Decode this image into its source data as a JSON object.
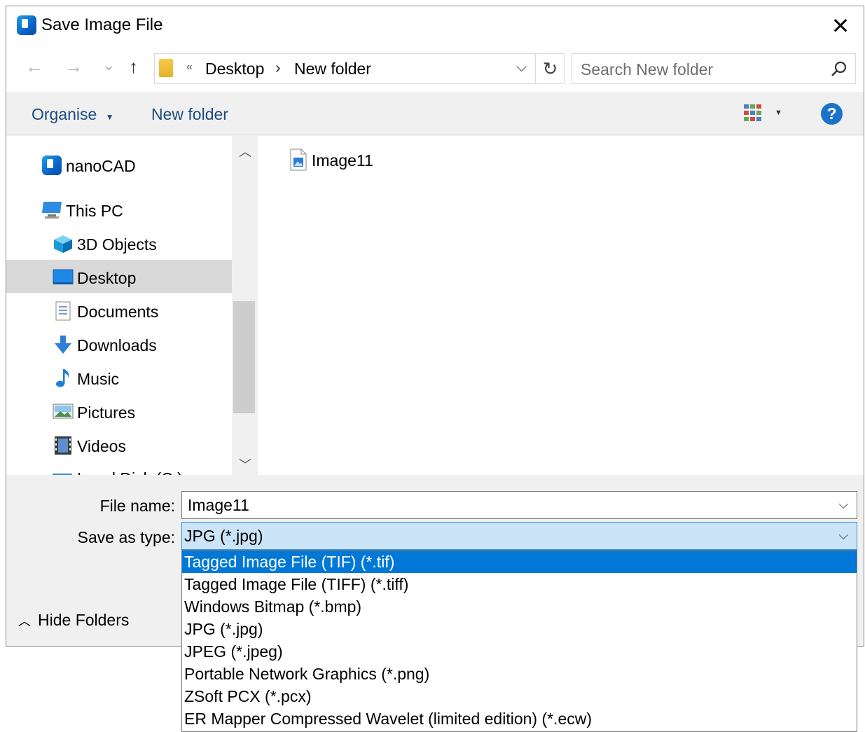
{
  "window": {
    "title": "Save Image File",
    "close_label": "✕"
  },
  "nav": {
    "back_icon": "←",
    "forward_icon": "→",
    "recent_icon": "⌄",
    "up_icon": "↑",
    "address": {
      "overflow": "«",
      "crumbs": [
        "Desktop",
        "New folder"
      ],
      "separator": "›"
    },
    "refresh_icon": "↻",
    "search_placeholder": "Search New folder"
  },
  "toolbar": {
    "organise_label": "Organise",
    "new_folder_label": "New folder"
  },
  "sidebar": {
    "items": [
      {
        "label": "nanoCAD",
        "icon": "nanocad-icon"
      },
      {
        "label": "This PC",
        "icon": "computer-icon"
      },
      {
        "label": "3D Objects",
        "icon": "cube-icon"
      },
      {
        "label": "Desktop",
        "icon": "desktop-icon",
        "selected": true
      },
      {
        "label": "Documents",
        "icon": "document-icon"
      },
      {
        "label": "Downloads",
        "icon": "download-icon"
      },
      {
        "label": "Music",
        "icon": "music-icon"
      },
      {
        "label": "Pictures",
        "icon": "picture-icon"
      },
      {
        "label": "Videos",
        "icon": "video-icon"
      },
      {
        "label": "Local Disk (C:)",
        "icon": "drive-icon"
      }
    ]
  },
  "files": [
    {
      "name": "Image11",
      "icon": "image-file-icon"
    }
  ],
  "form": {
    "file_name_label": "File name:",
    "file_name_value": "Image11",
    "save_type_label": "Save as type:",
    "save_type_value": "JPG (*.jpg)"
  },
  "type_options": [
    "Tagged Image File (TIF) (*.tif)",
    "Tagged Image File (TIFF) (*.tiff)",
    "Windows Bitmap (*.bmp)",
    "JPG (*.jpg)",
    "JPEG (*.jpeg)",
    "Portable Network Graphics (*.png)",
    "ZSoft PCX (*.pcx)",
    "ER Mapper Compressed Wavelet (limited edition) (*.ecw)"
  ],
  "hide_folders_label": "Hide Folders",
  "colors": {
    "accent": "#0078d7",
    "selected_nav": "#d9d9d9",
    "toolbar_text": "#1a4b7f"
  }
}
